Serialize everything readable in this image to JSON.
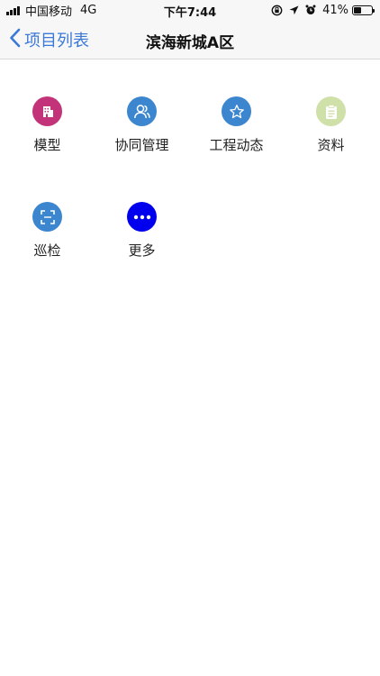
{
  "status_bar": {
    "carrier": "中国移动",
    "network": "4G",
    "time": "下午7:44",
    "battery_percent": "41%",
    "battery_level": 0.41
  },
  "nav": {
    "back_label": "项目列表",
    "title": "滨海新城A区"
  },
  "grid": {
    "items": [
      {
        "label": "模型",
        "icon": "building-icon",
        "color": "#c2337a"
      },
      {
        "label": "协同管理",
        "icon": "users-icon",
        "color": "#3b86cf"
      },
      {
        "label": "工程动态",
        "icon": "star-icon",
        "color": "#3b86cf"
      },
      {
        "label": "资料",
        "icon": "clipboard-icon",
        "color": "#cfe0a8"
      },
      {
        "label": "巡检",
        "icon": "scan-icon",
        "color": "#3b86cf"
      },
      {
        "label": "更多",
        "icon": "more-icon",
        "color": "#0000ee"
      }
    ]
  }
}
